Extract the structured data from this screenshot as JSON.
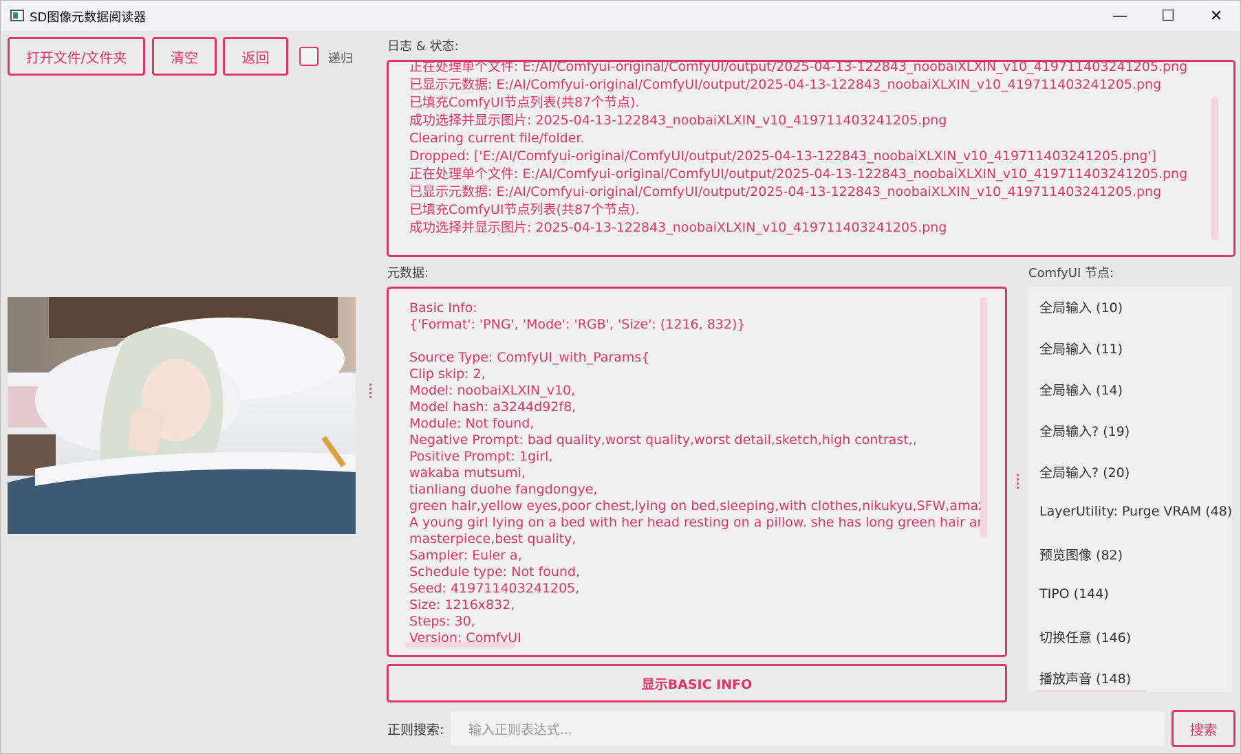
{
  "window": {
    "title": "SD图像元数据阅读器",
    "controls": {
      "minimize": "—",
      "maximize": "☐",
      "close": "✕"
    }
  },
  "toolbar": {
    "open_label": "打开文件/文件夹",
    "clear_label": "清空",
    "back_label": "返回",
    "recursive_label": "递归",
    "recursive_checked": false
  },
  "log": {
    "label": "日志 & 状态:",
    "lines": [
      "正在处理单个文件: E:/AI/Comfyui-original/ComfyUI/output/2025-04-13-122843_noobaiXLXIN_v10_419711403241205.png",
      "已显示元数据: E:/AI/Comfyui-original/ComfyUI/output/2025-04-13-122843_noobaiXLXIN_v10_419711403241205.png",
      "已填充ComfyUI节点列表(共87个节点).",
      "成功选择并显示图片: 2025-04-13-122843_noobaiXLXIN_v10_419711403241205.png",
      "Clearing current file/folder.",
      "Dropped: ['E:/AI/Comfyui-original/ComfyUI/output/2025-04-13-122843_noobaiXLXIN_v10_419711403241205.png']",
      "正在处理单个文件: E:/AI/Comfyui-original/ComfyUI/output/2025-04-13-122843_noobaiXLXIN_v10_419711403241205.png",
      "已显示元数据: E:/AI/Comfyui-original/ComfyUI/output/2025-04-13-122843_noobaiXLXIN_v10_419711403241205.png",
      "已填充ComfyUI节点列表(共87个节点).",
      "成功选择并显示图片: 2025-04-13-122843_noobaiXLXIN_v10_419711403241205.png"
    ]
  },
  "metadata": {
    "label": "元数据:",
    "lines": [
      "Basic Info:",
      "{'Format': 'PNG', 'Mode': 'RGB', 'Size': (1216, 832)}",
      "",
      "Source Type: ComfyUI_with_Params{",
      "Clip skip:  2,",
      "Model:  noobaiXLXIN_v10,",
      "Model hash:  a3244d92f8,",
      "Module:  Not found,",
      "Negative Prompt:  bad quality,worst quality,worst detail,sketch,high contrast,,",
      "Positive Prompt:  1girl,",
      "wakaba mutsumi,",
      "tianliang duohe fangdongye,",
      "green hair,yellow eyes,poor chest,lying on bed,sleeping,with clothes,nikukyu,SFW,amazing quality,",
      "A young girl lying on a bed with her head resting on a pillow. she has long green hair and is wearing",
      "masterpiece,best quality,",
      "Sampler:  Euler a,",
      "Schedule type:  Not found,",
      "Seed:  419711403241205,",
      "Size:  1216x832,",
      "Steps:  30,",
      "Version:  ComfyUI"
    ],
    "toggle_label": "显示BASIC INFO"
  },
  "nodes": {
    "label": "ComfyUI 节点:",
    "items": [
      "全局输入 (10)",
      "全局输入 (11)",
      "全局输入 (14)",
      "全局输入? (19)",
      "全局输入? (20)",
      "LayerUtility: Purge VRAM (48)",
      "预览图像 (82)",
      "TIPO (144)",
      "切换任意 (146)",
      "播放声音 (148)"
    ]
  },
  "search": {
    "label": "正则搜索:",
    "placeholder": "输入正则表达式...",
    "button_label": "搜索"
  },
  "colors": {
    "accent": "#e0356a",
    "background": "#e9e8e8",
    "panel": "#f0f0f0"
  }
}
